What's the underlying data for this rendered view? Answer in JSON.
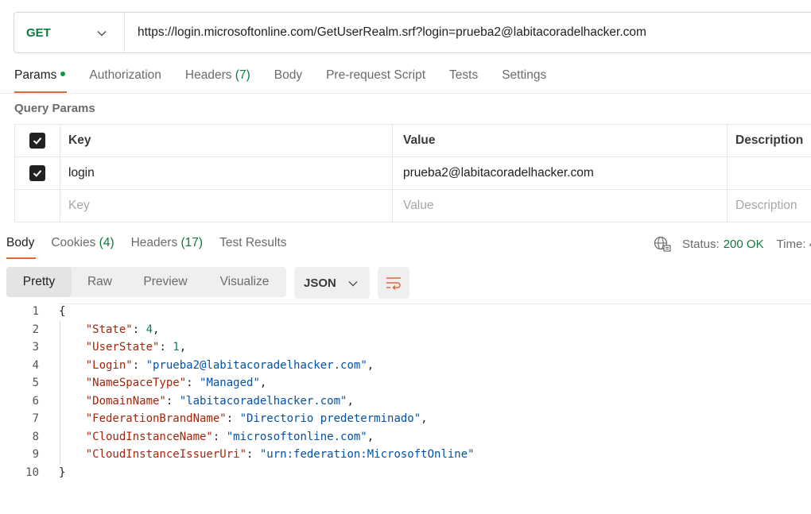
{
  "request": {
    "method": "GET",
    "url": "https://login.microsoftonline.com/GetUserRealm.srf?login=prueba2@labitacoradelhacker.com"
  },
  "request_tabs": [
    {
      "label": "Params",
      "count": ""
    },
    {
      "label": "Authorization",
      "count": ""
    },
    {
      "label": "Headers",
      "count": "(7)"
    },
    {
      "label": "Body",
      "count": ""
    },
    {
      "label": "Pre-request Script",
      "count": ""
    },
    {
      "label": "Tests",
      "count": ""
    },
    {
      "label": "Settings",
      "count": ""
    }
  ],
  "query_params": {
    "title": "Query Params",
    "headers": {
      "key": "Key",
      "value": "Value",
      "description": "Description"
    },
    "rows": [
      {
        "checked": true,
        "key": "login",
        "value": "prueba2@labitacoradelhacker.com",
        "description": ""
      }
    ],
    "placeholders": {
      "key": "Key",
      "value": "Value",
      "description": "Description"
    }
  },
  "response_tabs": [
    {
      "label": "Body",
      "count": ""
    },
    {
      "label": "Cookies",
      "count": "(4)"
    },
    {
      "label": "Headers",
      "count": "(17)"
    },
    {
      "label": "Test Results",
      "count": ""
    }
  ],
  "status": {
    "label": "Status:",
    "value": "200 OK",
    "time_label": "Time: 4"
  },
  "view_modes": [
    "Pretty",
    "Raw",
    "Preview",
    "Visualize"
  ],
  "format": "JSON",
  "icons": {
    "dropdown": "chevron-down-icon",
    "wrap": "wrap-lines-icon",
    "globe": "globe-network-icon",
    "checkbox": "checkbox-checked-icon"
  },
  "colors": {
    "accent": "#e0683a",
    "success": "#0b7a3e",
    "json_key": "#a1260d",
    "json_string": "#0451a5",
    "json_number": "#098658"
  },
  "response_body": [
    {
      "num": "1",
      "indent": "",
      "key": "",
      "value": "{",
      "type": "punct",
      "comma": ""
    },
    {
      "num": "2",
      "indent": "    ",
      "key": "\"State\"",
      "value": "4",
      "type": "number",
      "comma": ","
    },
    {
      "num": "3",
      "indent": "    ",
      "key": "\"UserState\"",
      "value": "1",
      "type": "number",
      "comma": ","
    },
    {
      "num": "4",
      "indent": "    ",
      "key": "\"Login\"",
      "value": "\"prueba2@labitacoradelhacker.com\"",
      "type": "string",
      "comma": ","
    },
    {
      "num": "5",
      "indent": "    ",
      "key": "\"NameSpaceType\"",
      "value": "\"Managed\"",
      "type": "string",
      "comma": ","
    },
    {
      "num": "6",
      "indent": "    ",
      "key": "\"DomainName\"",
      "value": "\"labitacoradelhacker.com\"",
      "type": "string",
      "comma": ","
    },
    {
      "num": "7",
      "indent": "    ",
      "key": "\"FederationBrandName\"",
      "value": "\"Directorio predeterminado\"",
      "type": "string",
      "comma": ","
    },
    {
      "num": "8",
      "indent": "    ",
      "key": "\"CloudInstanceName\"",
      "value": "\"microsoftonline.com\"",
      "type": "string",
      "comma": ","
    },
    {
      "num": "9",
      "indent": "    ",
      "key": "\"CloudInstanceIssuerUri\"",
      "value": "\"urn:federation:MicrosoftOnline\"",
      "type": "string",
      "comma": ""
    },
    {
      "num": "10",
      "indent": "",
      "key": "",
      "value": "}",
      "type": "punct",
      "comma": ""
    }
  ]
}
